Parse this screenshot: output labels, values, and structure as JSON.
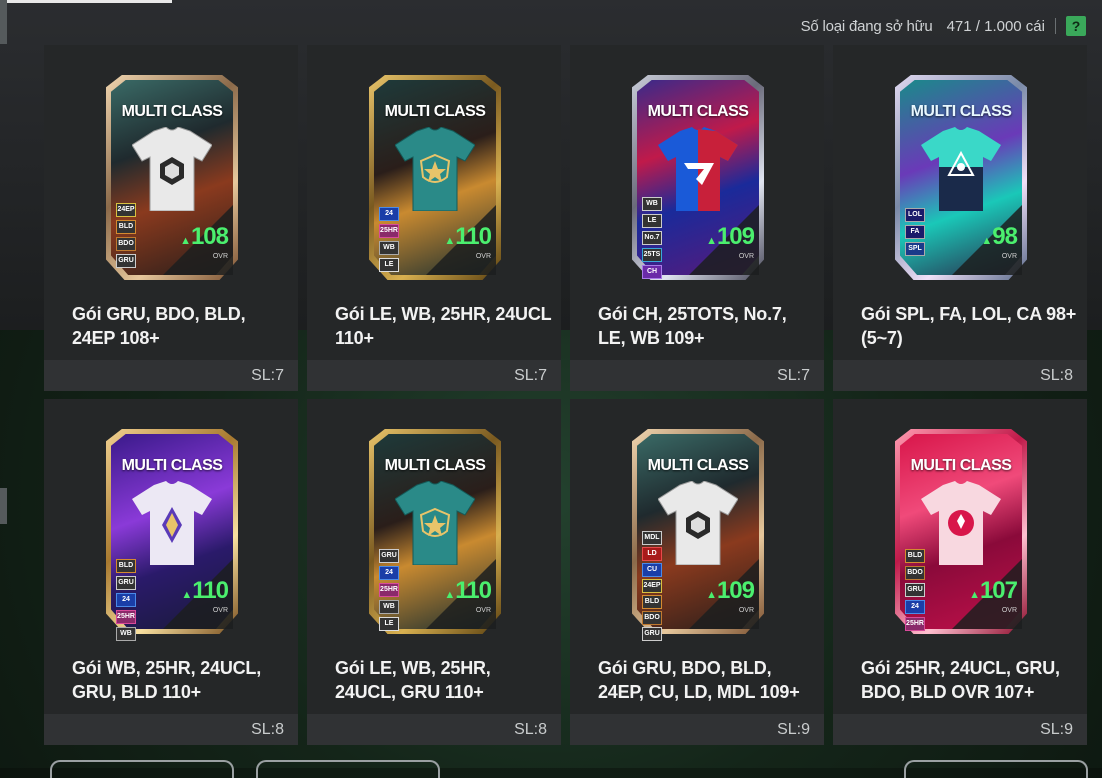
{
  "header": {
    "label": "Số loại đang sở hữu",
    "count": "471 / 1.000 cái",
    "help": "?"
  },
  "colors": {
    "accent_green": "#4bef6e",
    "panel": "#252728",
    "footer": "#303234"
  },
  "packs": [
    {
      "title": "Gói GRU, BDO, BLD, 24EP 108+",
      "qty": "SL:7",
      "card_class": "MULTI CLASS",
      "ovr": "108",
      "ovr_label": "OVR",
      "tags": [
        "24EP",
        "BLD",
        "BDO",
        "GRU"
      ]
    },
    {
      "title": "Gói LE, WB, 25HR, 24UCL 110+",
      "qty": "SL:7",
      "card_class": "MULTI CLASS",
      "ovr": "110",
      "ovr_label": "OVR",
      "tags": [
        "24",
        "25HR",
        "WB",
        "LE"
      ]
    },
    {
      "title": "Gói CH, 25TOTS, No.7, LE, WB 109+",
      "qty": "SL:7",
      "card_class": "MULTI CLASS",
      "ovr": "109",
      "ovr_label": "OVR",
      "tags": [
        "WB",
        "LE",
        "No.7",
        "25TS",
        "CH"
      ]
    },
    {
      "title": "Gói SPL, FA, LOL, CA 98+ (5~7)",
      "qty": "SL:8",
      "card_class": "MULTI CLASS",
      "ovr": "98",
      "ovr_label": "OVR",
      "tags": [
        "LOL",
        "FA",
        "SPL"
      ]
    },
    {
      "title": "Gói WB, 25HR, 24UCL, GRU, BLD 110+",
      "qty": "SL:8",
      "card_class": "MULTI CLASS",
      "ovr": "110",
      "ovr_label": "OVR",
      "tags": [
        "BLD",
        "GRU",
        "24",
        "25HR",
        "WB"
      ]
    },
    {
      "title": "Gói LE, WB, 25HR, 24UCL, GRU 110+",
      "qty": "SL:8",
      "card_class": "MULTI CLASS",
      "ovr": "110",
      "ovr_label": "OVR",
      "tags": [
        "GRU",
        "24",
        "25HR",
        "WB",
        "LE"
      ]
    },
    {
      "title": "Gói GRU, BDO, BLD, 24EP, CU, LD, MDL 109+",
      "qty": "SL:9",
      "card_class": "MULTI CLASS",
      "ovr": "109",
      "ovr_label": "OVR",
      "tags": [
        "MDL",
        "LD",
        "CU",
        "24EP",
        "BLD",
        "BDO",
        "GRU"
      ]
    },
    {
      "title": "Gói 25HR, 24UCL, GRU, BDO, BLD OVR 107+",
      "qty": "SL:9",
      "card_class": "MULTI CLASS",
      "ovr": "107",
      "ovr_label": "OVR",
      "tags": [
        "BLD",
        "BDO",
        "GRU",
        "24",
        "25HR"
      ]
    }
  ]
}
